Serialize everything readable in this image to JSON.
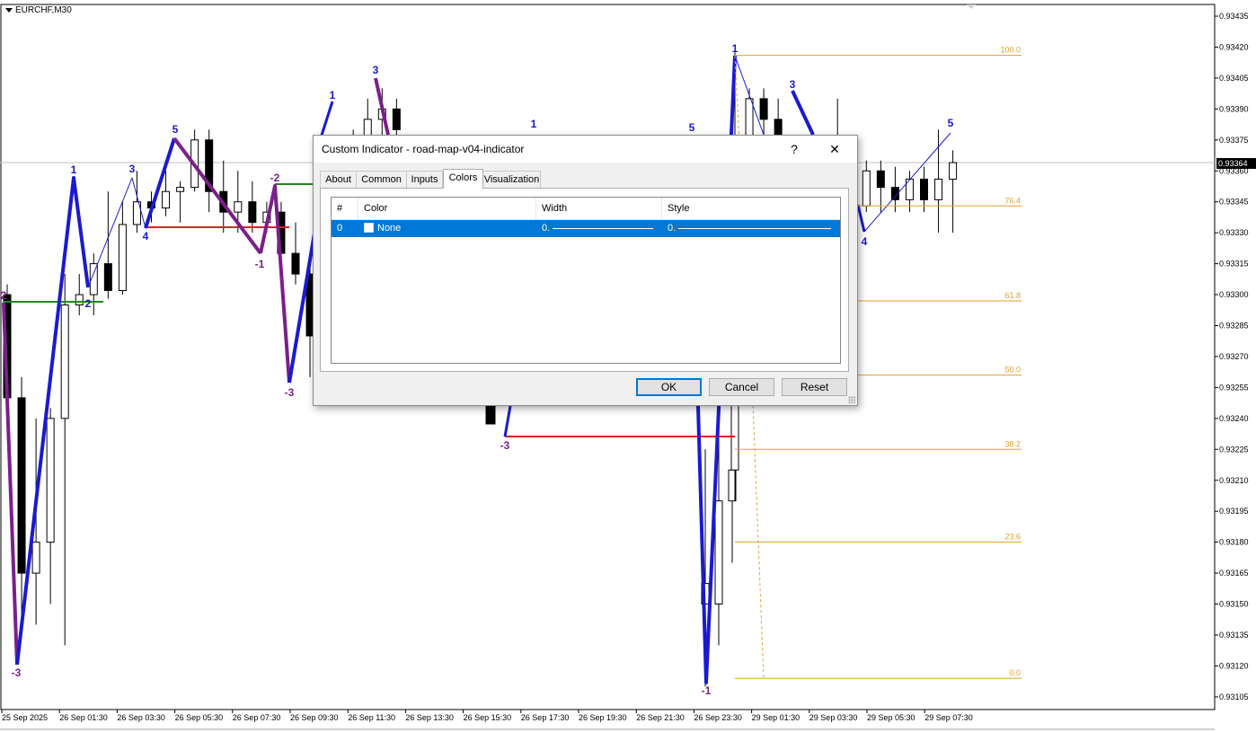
{
  "chart": {
    "symbol": "EURCHF,M30",
    "current_price": "0.93364",
    "price_labels": [
      "0.93435",
      "0.93420",
      "0.93405",
      "0.93390",
      "0.93375",
      "0.93360",
      "0.93345",
      "0.93330",
      "0.93315",
      "0.93300",
      "0.93285",
      "0.93270",
      "0.93255",
      "0.93240",
      "0.93225",
      "0.93210",
      "0.93195",
      "0.93180",
      "0.93165",
      "0.93150",
      "0.93135",
      "0.93120",
      "0.93105"
    ],
    "time_labels": [
      "25 Sep 2025",
      "26 Sep 01:30",
      "26 Sep 03:30",
      "26 Sep 05:30",
      "26 Sep 07:30",
      "26 Sep 09:30",
      "26 Sep 11:30",
      "26 Sep 13:30",
      "26 Sep 15:30",
      "26 Sep 17:30",
      "26 Sep 19:30",
      "26 Sep 21:30",
      "26 Sep 23:30",
      "29 Sep 01:30",
      "29 Sep 03:30",
      "29 Sep 05:30",
      "29 Sep 07:30"
    ],
    "fib_levels": [
      "100.0",
      "76.4",
      "61.8",
      "50.0",
      "38.2",
      "23.6",
      "0.0"
    ],
    "fib_values": [
      0.93416,
      0.93343,
      0.93297,
      0.93261,
      0.93225,
      0.9318,
      0.93114
    ],
    "wave_labels": [
      {
        "text": "2",
        "color": "#7b1f8b",
        "t": 0,
        "p": 0.93302
      },
      {
        "text": "-3",
        "color": "#7b1f8b",
        "t": 0.8,
        "p": 0.93112
      },
      {
        "text": "1",
        "color": "#1a1ad0",
        "t": 3.2,
        "p": 0.93363
      },
      {
        "text": "2",
        "color": "#1a1ad0",
        "t": 3.8,
        "p": 0.93302
      },
      {
        "text": "3",
        "color": "#1a1ad0",
        "t": 5.7,
        "p": 0.93362
      },
      {
        "text": "4",
        "color": "#1a1ad0",
        "t": 6.3,
        "p": 0.93324
      },
      {
        "text": "5",
        "color": "#1a1ad0",
        "t": 7.6,
        "p": 0.93382
      },
      {
        "text": "-1",
        "color": "#7b1f8b",
        "t": 11.3,
        "p": 0.93312
      },
      {
        "text": "-2",
        "color": "#7b1f8b",
        "t": 11.9,
        "p": 0.93358
      },
      {
        "text": "-3",
        "color": "#7b1f8b",
        "t": 12.5,
        "p": 0.9325
      },
      {
        "text": "1",
        "color": "#1a1ad0",
        "t": 14.5,
        "p": 0.93402
      },
      {
        "text": "3",
        "color": "#1a1ad0",
        "t": 16.3,
        "p": 0.93418
      },
      {
        "text": "1",
        "color": "#1a1ad0",
        "t": 23.2,
        "p": 0.93387
      },
      {
        "text": "-3",
        "color": "#7b1f8b",
        "t": 22.0,
        "p": 0.93221
      },
      {
        "text": "5",
        "color": "#1a1ad0",
        "t": 30.1,
        "p": 0.93384
      },
      {
        "text": "1",
        "color": "#1a1ad0",
        "t": 32.0,
        "p": 0.93428
      },
      {
        "text": "3",
        "color": "#1a1ad0",
        "t": 34.5,
        "p": 0.93408
      },
      {
        "text": "-1",
        "color": "#7b1f8b",
        "t": 30.7,
        "p": 0.93108
      },
      {
        "text": "4",
        "color": "#1a1ad0",
        "t": 37.7,
        "p": 0.93322
      },
      {
        "text": "5",
        "color": "#1a1ad0",
        "t": 41.5,
        "p": 0.93387
      }
    ]
  },
  "dialog": {
    "title": "Custom Indicator - road-map-v04-indicator",
    "help": "?",
    "close": "✕",
    "tabs": [
      "About",
      "Common",
      "Inputs",
      "Colors",
      "Visualization"
    ],
    "active_tab": "Colors",
    "columns": [
      "#",
      "Color",
      "Width",
      "Style"
    ],
    "rows": [
      {
        "index": "0",
        "color": "None",
        "width": "0.",
        "style": "0."
      }
    ],
    "buttons": {
      "ok": "OK",
      "cancel": "Cancel",
      "reset": "Reset"
    }
  }
}
